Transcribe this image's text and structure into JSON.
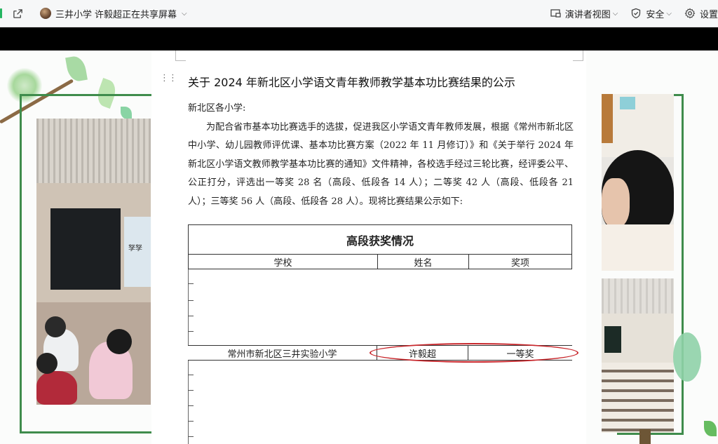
{
  "toolbar": {
    "meeting_name": "三井小学",
    "share_status": "许毅超正在共享屏幕",
    "presenter_view_label": "演讲者视图",
    "security_label": "安全",
    "settings_label": "设置"
  },
  "document": {
    "title": "关于 2024 年新北区小学语文青年教师教学基本功比赛结果的公示",
    "greeting": "新北区各小学:",
    "paragraph": "为配合省市基本功比赛选手的选拔，促进我区小学语文青年教师发展，根据《常州市新北区中小学、幼儿园教师评优课、基本功比赛方案（2022 年 11 月修订）》和《关于举行 2024 年新北区小学语文教师教学基本功比赛的通知》文件精神，各校选手经过三轮比赛，经评委公平、公正打分，评选出一等奖 28 名（高段、低段各 14 人）；二等奖 42 人（高段、低段各 21 人）；三等奖 56 人（高段、低段各 28 人）。现将比赛结果公示如下:",
    "table": {
      "heading": "高段获奖情况",
      "columns": [
        "学校",
        "姓名",
        "奖项"
      ],
      "highlighted_row": {
        "school": "常州市新北区三井实验小学",
        "name": "许毅超",
        "award": "一等奖"
      }
    }
  },
  "photo": {
    "screen_text": "孥孥"
  },
  "colors": {
    "frame_green": "#3f8c4c",
    "highlight_red": "#c8262b"
  },
  "icons": [
    "external-link-icon",
    "avatar",
    "chevron-down-icon",
    "presenter-view-icon",
    "shield-icon",
    "gear-icon",
    "drag-handle-icon"
  ]
}
